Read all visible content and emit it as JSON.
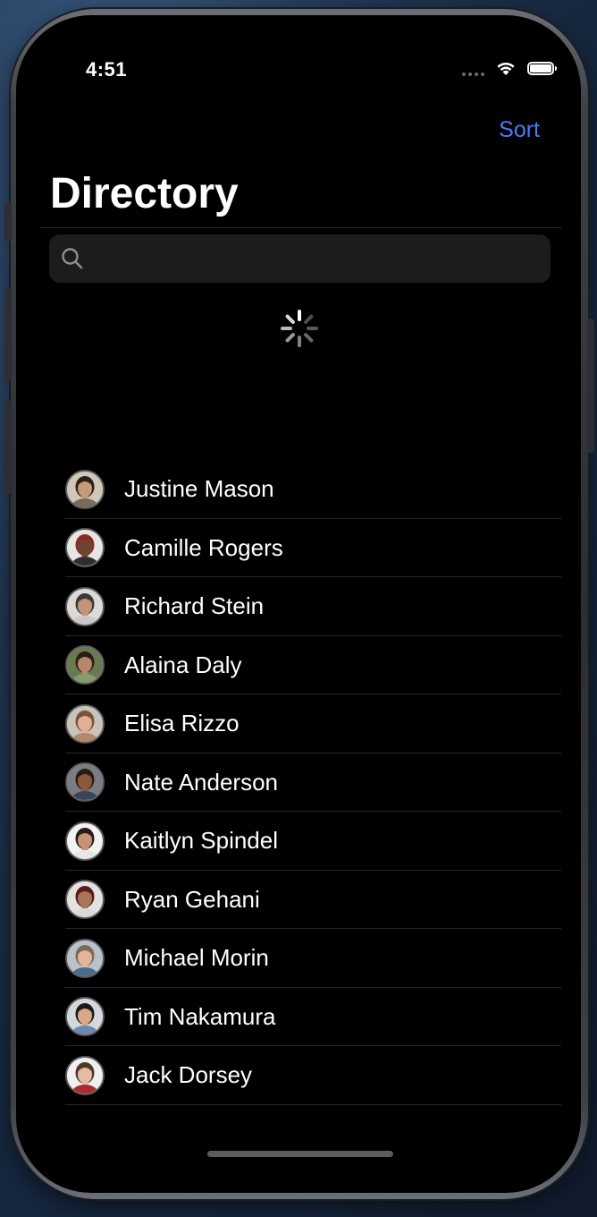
{
  "status_bar": {
    "time": "4:51"
  },
  "nav": {
    "sort_label": "Sort",
    "title": "Directory"
  },
  "search": {
    "placeholder": ""
  },
  "colors": {
    "accent": "#4a7cf5",
    "background": "#000000",
    "search_field": "#1c1c1e"
  },
  "contacts": [
    {
      "name": "Justine Mason",
      "skin": "#c99a78",
      "hair": "#2a1f1a",
      "shirt": "#7a6a58",
      "bg": "#cfc7b8"
    },
    {
      "name": "Camille Rogers",
      "skin": "#6b4530",
      "hair": "#8b2a2a",
      "shirt": "#2e2e2e",
      "bg": "#e8e6e2"
    },
    {
      "name": "Richard Stein",
      "skin": "#c49476",
      "hair": "#3a3a3a",
      "shirt": "#c8c8c8",
      "bg": "#dcdad6"
    },
    {
      "name": "Alaina Daly",
      "skin": "#b88668",
      "hair": "#2a1d17",
      "shirt": "#8a9a70",
      "bg": "#6a7a50"
    },
    {
      "name": "Elisa Rizzo",
      "skin": "#e0b096",
      "hair": "#7a5236",
      "shirt": "#b08a6a",
      "bg": "#c8c4bc"
    },
    {
      "name": "Nate Anderson",
      "skin": "#8b5a3c",
      "hair": "#2a1a12",
      "shirt": "#3a4658",
      "bg": "#7a7e84"
    },
    {
      "name": "Kaitlyn Spindel",
      "skin": "#c89274",
      "hair": "#2a1d17",
      "shirt": "#e6e6e6",
      "bg": "#f2f2f2"
    },
    {
      "name": "Ryan Gehani",
      "skin": "#a87654",
      "hair": "#5a1a22",
      "shirt": "#dadada",
      "bg": "#e4e2de"
    },
    {
      "name": "Michael Morin",
      "skin": "#e2b498",
      "hair": "#7a6a58",
      "shirt": "#4a6a8a",
      "bg": "#b8c2c8"
    },
    {
      "name": "Tim Nakamura",
      "skin": "#d8a888",
      "hair": "#1a1a1a",
      "shirt": "#6a8ab0",
      "bg": "#d4d8dc"
    },
    {
      "name": "Jack Dorsey",
      "skin": "#e4bca4",
      "hair": "#4a3a2a",
      "shirt": "#b02a2a",
      "bg": "#f0f0f0"
    }
  ]
}
